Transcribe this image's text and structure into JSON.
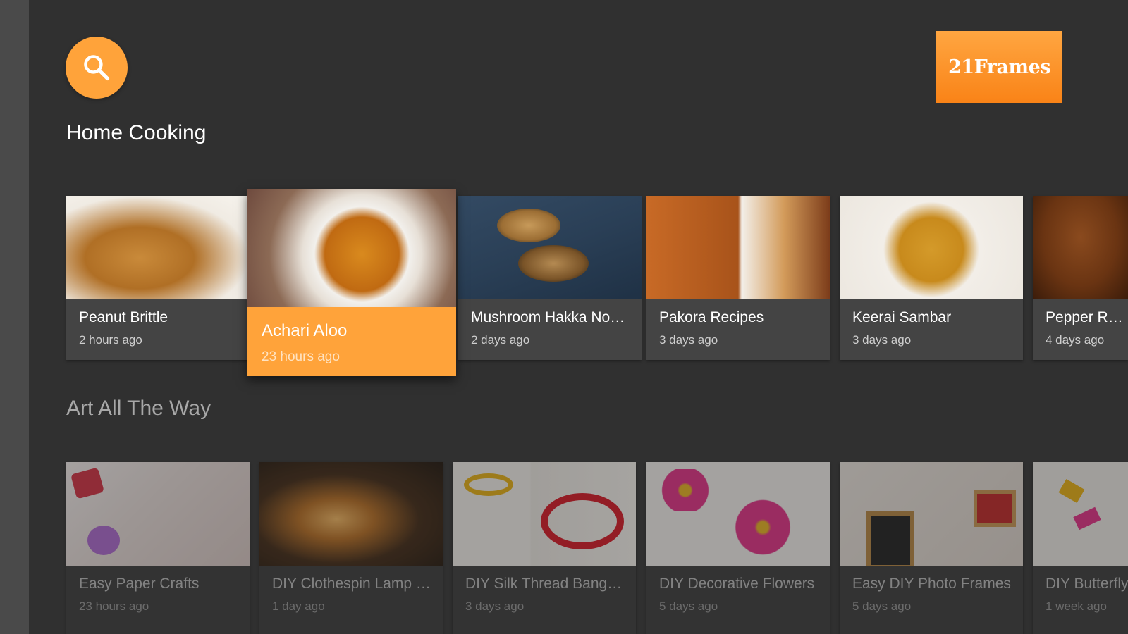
{
  "header": {
    "search_icon": "search-icon",
    "brand": "21Frames"
  },
  "rows": [
    {
      "title": "Home Cooking",
      "items": [
        {
          "title": "Peanut Brittle",
          "time": "2 hours ago"
        },
        {
          "title": "Achari Aloo",
          "time": "23 hours ago"
        },
        {
          "title": "Mushroom Hakka Noo...",
          "time": "2 days ago"
        },
        {
          "title": "Pakora Recipes",
          "time": "3 days ago"
        },
        {
          "title": "Keerai Sambar",
          "time": "3 days ago"
        },
        {
          "title": "Pepper Recip",
          "time": "4 days ago"
        }
      ]
    },
    {
      "title": "Art All The Way",
      "items": [
        {
          "title": "Easy Paper Crafts",
          "time": "23 hours ago"
        },
        {
          "title": "DIY Clothespin Lamp S...",
          "time": "1 day ago"
        },
        {
          "title": "DIY Silk Thread Bangles",
          "time": "3 days ago"
        },
        {
          "title": "DIY Decorative Flowers",
          "time": "5 days ago"
        },
        {
          "title": "Easy DIY Photo Frames",
          "time": "5 days ago"
        },
        {
          "title": "DIY Butterfly",
          "time": "1 week ago"
        }
      ]
    }
  ],
  "colors": {
    "accent": "#ffa33a",
    "background": "#303030",
    "card": "#444444"
  }
}
